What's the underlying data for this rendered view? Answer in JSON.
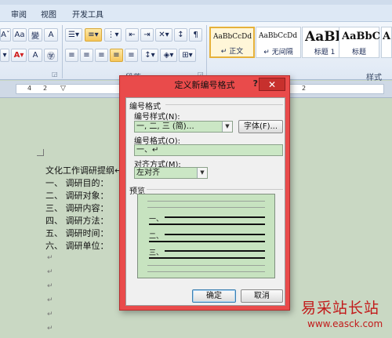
{
  "tabs": [
    "审阅",
    "视图",
    "开发工具"
  ],
  "ribbon": {
    "paragraph_group_label": "段落",
    "styles_group_label": "样式",
    "styles": [
      {
        "sample": "AaBbCcDd",
        "name": "正文"
      },
      {
        "sample": "AaBbCcDd",
        "name": "无间隔"
      },
      {
        "sample": "AaBl",
        "name": "标题 1"
      },
      {
        "sample": "AaBbC",
        "name": "标题"
      },
      {
        "sample": "A",
        "name": ""
      }
    ]
  },
  "ruler": {
    "numbers": [
      "4",
      "2",
      "2"
    ]
  },
  "document": {
    "lines": [
      "文化工作调研提纲↵",
      "一、    调研目的：",
      "二、    调研对象：",
      "三、    调研内容：",
      "四、    调研方法：",
      "五、    调研时间：",
      "六、    调研单位："
    ],
    "para_mark": "↵"
  },
  "dialog": {
    "title": "定义新编号格式",
    "help": "?",
    "close": "✕",
    "section_label": "编号格式",
    "style_label": "编号样式(N):",
    "style_value": "一, 二, 三 (简)…",
    "font_button": "字体(F)...",
    "format_label": "编号格式(O):",
    "format_value": "一、↵",
    "align_label": "对齐方式(M):",
    "align_value": "左对齐",
    "preview_label": "预览",
    "preview_items": [
      "一、",
      "二、",
      "三、"
    ],
    "ok_button": "确定",
    "cancel_button": "取消"
  },
  "watermark": {
    "text": "易采站长站",
    "url": "www.easck.com"
  }
}
